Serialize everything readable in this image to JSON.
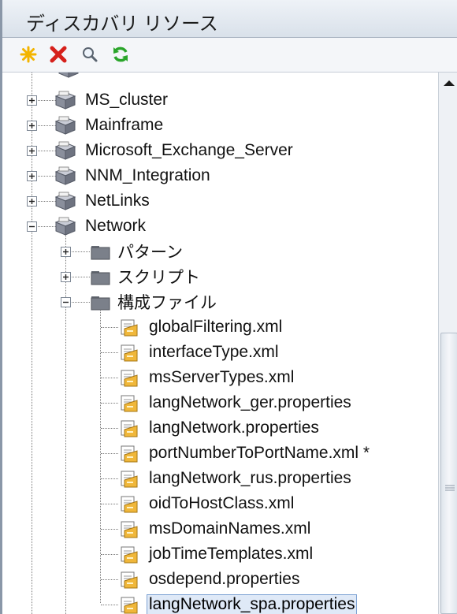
{
  "panel": {
    "title": "ディスカバリ リソース"
  },
  "toolbar": [
    {
      "icon": "new-star-icon",
      "color": "#f3b400"
    },
    {
      "icon": "delete-x-icon",
      "color": "#d6201b"
    },
    {
      "icon": "search-icon",
      "color": "#5a6470"
    },
    {
      "icon": "refresh-icon",
      "color": "#2aa52a"
    }
  ],
  "tree": {
    "packages": [
      "MS_cluster",
      "Mainframe",
      "Microsoft_Exchange_Server",
      "NNM_Integration",
      "NetLinks",
      "Network"
    ],
    "network_folders": [
      "パターン",
      "スクリプト",
      "構成ファイル"
    ],
    "config_files": [
      "globalFiltering.xml",
      "interfaceType.xml",
      "msServerTypes.xml",
      "langNetwork_ger.properties",
      "langNetwork.properties",
      "portNumberToPortName.xml *",
      "langNetwork_rus.properties",
      "oidToHostClass.xml",
      "msDomainNames.xml",
      "jobTimeTemplates.xml",
      "osdepend.properties",
      "langNetwork_spa.properties"
    ],
    "selected": "langNetwork_spa.properties"
  }
}
